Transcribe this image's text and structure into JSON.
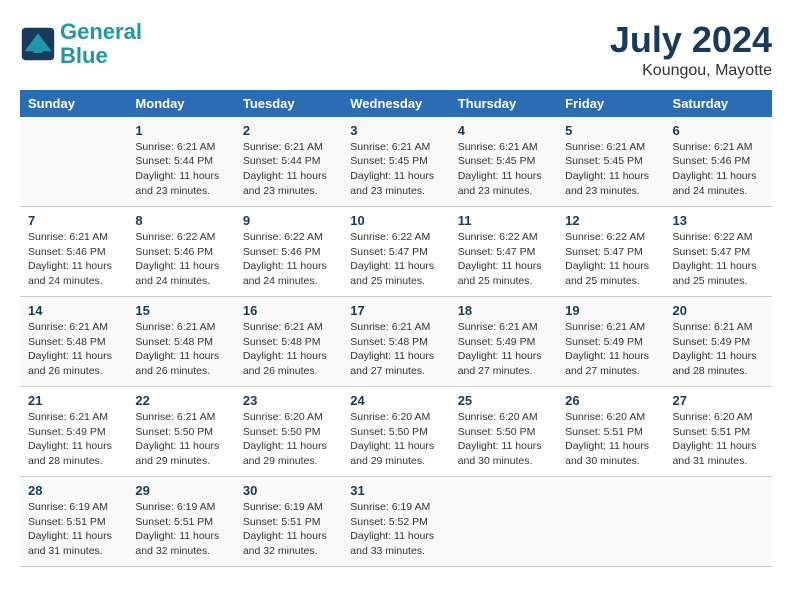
{
  "logo": {
    "line1": "General",
    "line2": "Blue"
  },
  "title": {
    "month_year": "July 2024",
    "location": "Koungou, Mayotte"
  },
  "days_of_week": [
    "Sunday",
    "Monday",
    "Tuesday",
    "Wednesday",
    "Thursday",
    "Friday",
    "Saturday"
  ],
  "weeks": [
    [
      {
        "day": "",
        "info": ""
      },
      {
        "day": "1",
        "info": "Sunrise: 6:21 AM\nSunset: 5:44 PM\nDaylight: 11 hours\nand 23 minutes."
      },
      {
        "day": "2",
        "info": "Sunrise: 6:21 AM\nSunset: 5:44 PM\nDaylight: 11 hours\nand 23 minutes."
      },
      {
        "day": "3",
        "info": "Sunrise: 6:21 AM\nSunset: 5:45 PM\nDaylight: 11 hours\nand 23 minutes."
      },
      {
        "day": "4",
        "info": "Sunrise: 6:21 AM\nSunset: 5:45 PM\nDaylight: 11 hours\nand 23 minutes."
      },
      {
        "day": "5",
        "info": "Sunrise: 6:21 AM\nSunset: 5:45 PM\nDaylight: 11 hours\nand 23 minutes."
      },
      {
        "day": "6",
        "info": "Sunrise: 6:21 AM\nSunset: 5:46 PM\nDaylight: 11 hours\nand 24 minutes."
      }
    ],
    [
      {
        "day": "7",
        "info": "Sunrise: 6:21 AM\nSunset: 5:46 PM\nDaylight: 11 hours\nand 24 minutes."
      },
      {
        "day": "8",
        "info": "Sunrise: 6:22 AM\nSunset: 5:46 PM\nDaylight: 11 hours\nand 24 minutes."
      },
      {
        "day": "9",
        "info": "Sunrise: 6:22 AM\nSunset: 5:46 PM\nDaylight: 11 hours\nand 24 minutes."
      },
      {
        "day": "10",
        "info": "Sunrise: 6:22 AM\nSunset: 5:47 PM\nDaylight: 11 hours\nand 25 minutes."
      },
      {
        "day": "11",
        "info": "Sunrise: 6:22 AM\nSunset: 5:47 PM\nDaylight: 11 hours\nand 25 minutes."
      },
      {
        "day": "12",
        "info": "Sunrise: 6:22 AM\nSunset: 5:47 PM\nDaylight: 11 hours\nand 25 minutes."
      },
      {
        "day": "13",
        "info": "Sunrise: 6:22 AM\nSunset: 5:47 PM\nDaylight: 11 hours\nand 25 minutes."
      }
    ],
    [
      {
        "day": "14",
        "info": "Sunrise: 6:21 AM\nSunset: 5:48 PM\nDaylight: 11 hours\nand 26 minutes."
      },
      {
        "day": "15",
        "info": "Sunrise: 6:21 AM\nSunset: 5:48 PM\nDaylight: 11 hours\nand 26 minutes."
      },
      {
        "day": "16",
        "info": "Sunrise: 6:21 AM\nSunset: 5:48 PM\nDaylight: 11 hours\nand 26 minutes."
      },
      {
        "day": "17",
        "info": "Sunrise: 6:21 AM\nSunset: 5:48 PM\nDaylight: 11 hours\nand 27 minutes."
      },
      {
        "day": "18",
        "info": "Sunrise: 6:21 AM\nSunset: 5:49 PM\nDaylight: 11 hours\nand 27 minutes."
      },
      {
        "day": "19",
        "info": "Sunrise: 6:21 AM\nSunset: 5:49 PM\nDaylight: 11 hours\nand 27 minutes."
      },
      {
        "day": "20",
        "info": "Sunrise: 6:21 AM\nSunset: 5:49 PM\nDaylight: 11 hours\nand 28 minutes."
      }
    ],
    [
      {
        "day": "21",
        "info": "Sunrise: 6:21 AM\nSunset: 5:49 PM\nDaylight: 11 hours\nand 28 minutes."
      },
      {
        "day": "22",
        "info": "Sunrise: 6:21 AM\nSunset: 5:50 PM\nDaylight: 11 hours\nand 29 minutes."
      },
      {
        "day": "23",
        "info": "Sunrise: 6:20 AM\nSunset: 5:50 PM\nDaylight: 11 hours\nand 29 minutes."
      },
      {
        "day": "24",
        "info": "Sunrise: 6:20 AM\nSunset: 5:50 PM\nDaylight: 11 hours\nand 29 minutes."
      },
      {
        "day": "25",
        "info": "Sunrise: 6:20 AM\nSunset: 5:50 PM\nDaylight: 11 hours\nand 30 minutes."
      },
      {
        "day": "26",
        "info": "Sunrise: 6:20 AM\nSunset: 5:51 PM\nDaylight: 11 hours\nand 30 minutes."
      },
      {
        "day": "27",
        "info": "Sunrise: 6:20 AM\nSunset: 5:51 PM\nDaylight: 11 hours\nand 31 minutes."
      }
    ],
    [
      {
        "day": "28",
        "info": "Sunrise: 6:19 AM\nSunset: 5:51 PM\nDaylight: 11 hours\nand 31 minutes."
      },
      {
        "day": "29",
        "info": "Sunrise: 6:19 AM\nSunset: 5:51 PM\nDaylight: 11 hours\nand 32 minutes."
      },
      {
        "day": "30",
        "info": "Sunrise: 6:19 AM\nSunset: 5:51 PM\nDaylight: 11 hours\nand 32 minutes."
      },
      {
        "day": "31",
        "info": "Sunrise: 6:19 AM\nSunset: 5:52 PM\nDaylight: 11 hours\nand 33 minutes."
      },
      {
        "day": "",
        "info": ""
      },
      {
        "day": "",
        "info": ""
      },
      {
        "day": "",
        "info": ""
      }
    ]
  ]
}
